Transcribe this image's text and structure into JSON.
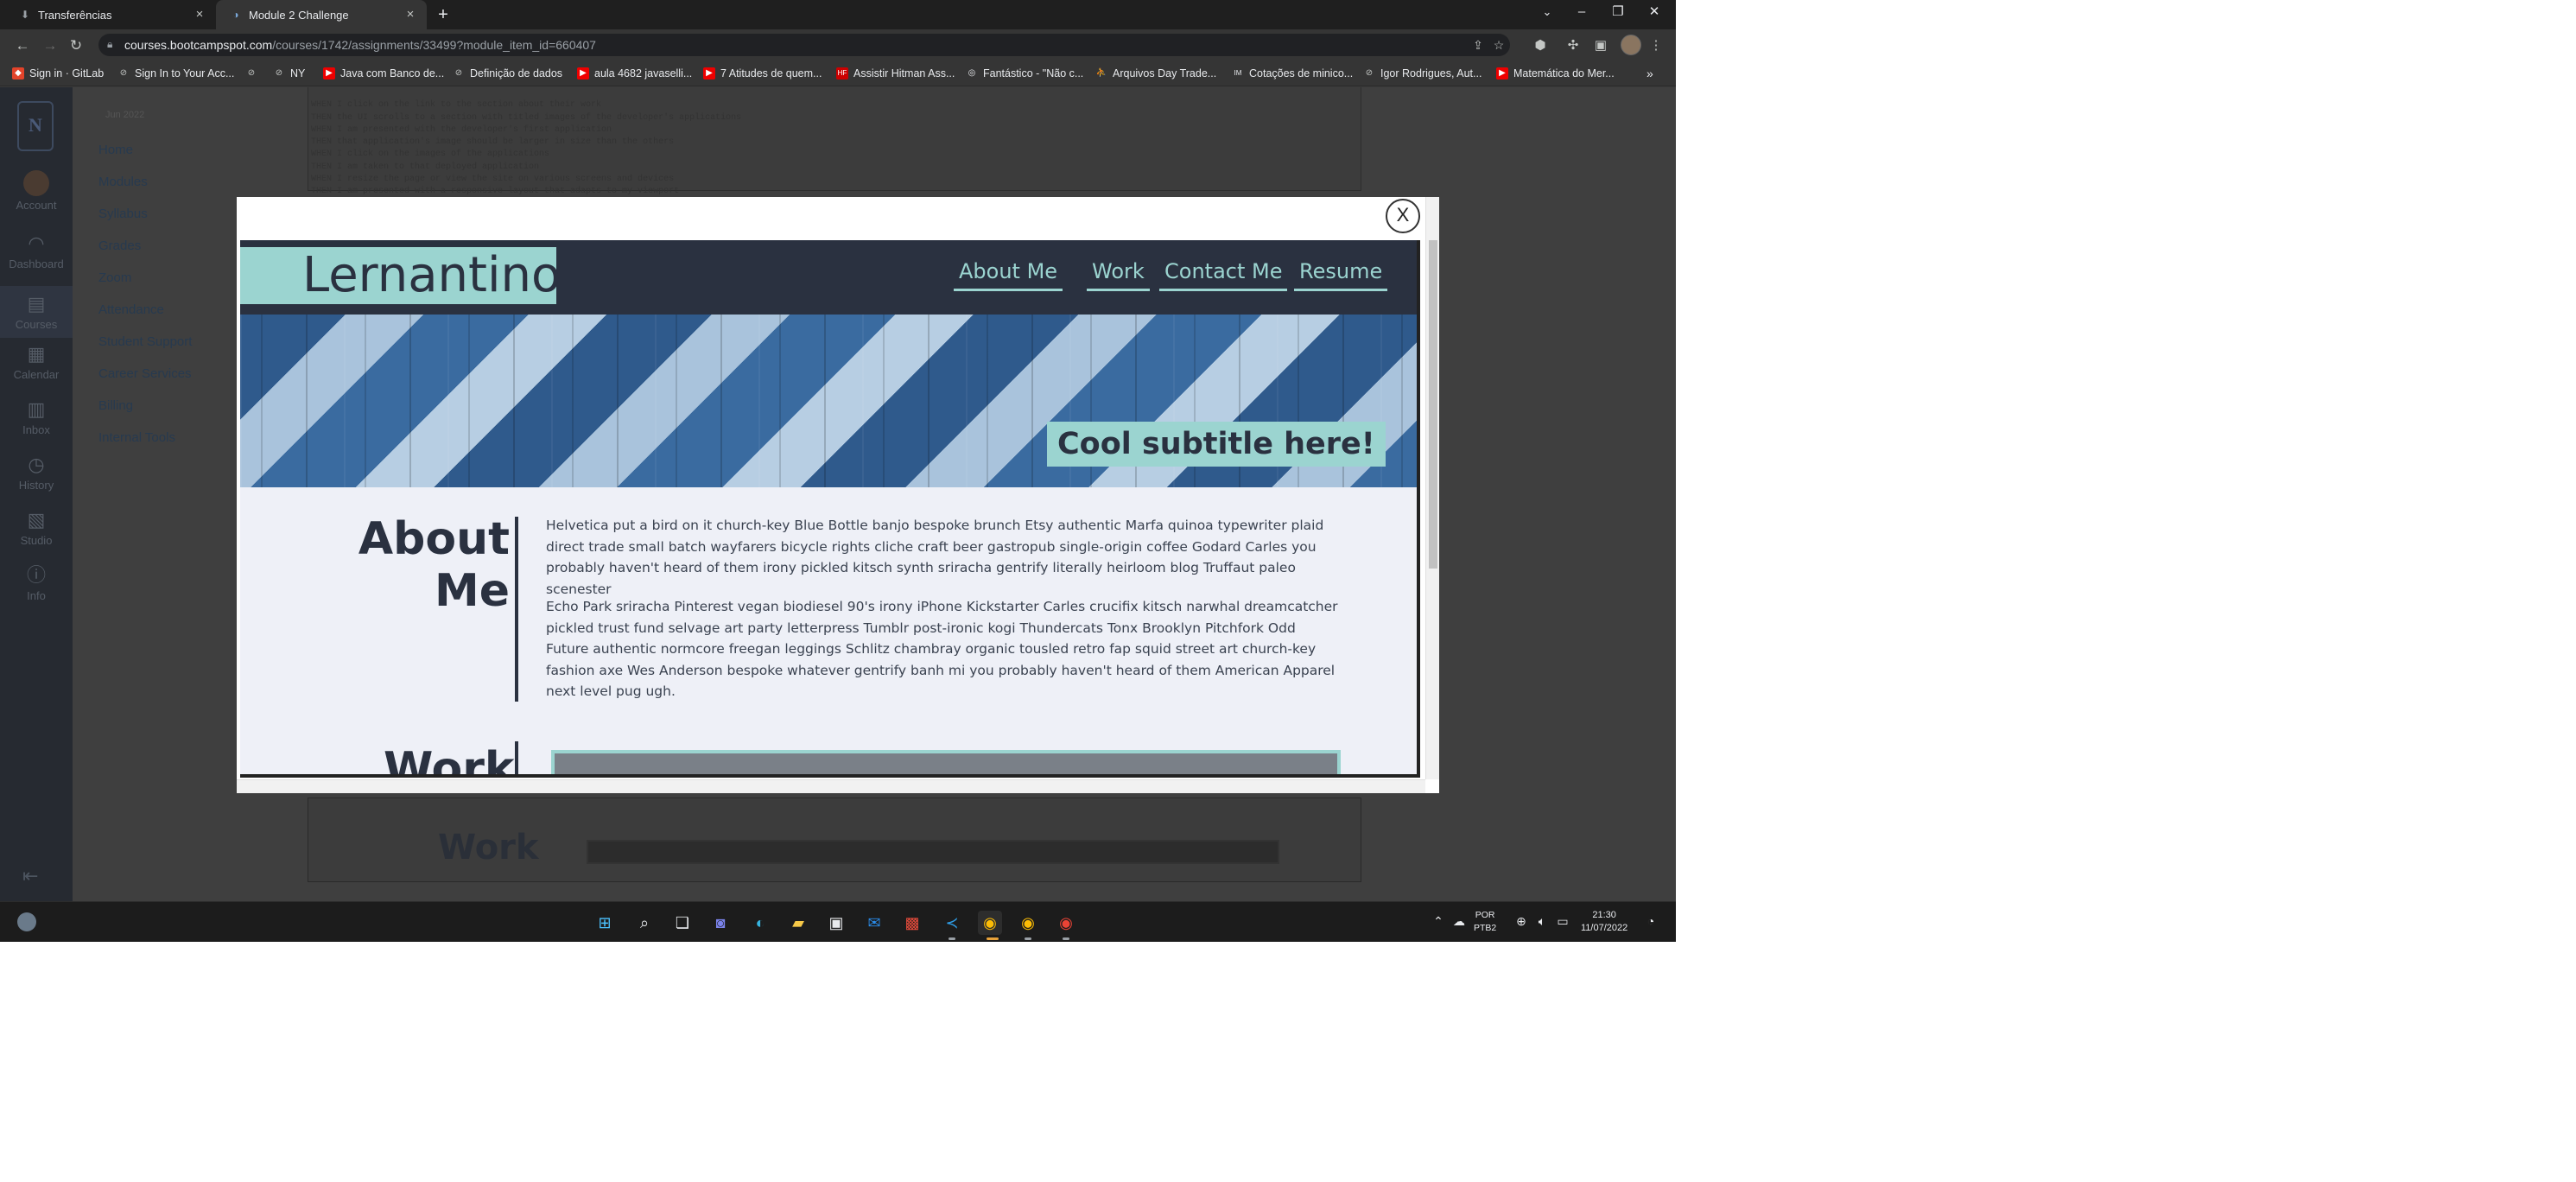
{
  "browser": {
    "tabs": [
      {
        "title": "Transferências",
        "icon": "download-icon"
      },
      {
        "title": "Module 2 Challenge",
        "icon": "canvas-icon"
      }
    ],
    "url_domain": "courses.bootcampspot.com",
    "url_path": "/courses/1742/assignments/33499?module_item_id=660407",
    "bookmarks": [
      "Sign in · GitLab",
      "Sign In to Your Acc...",
      "NY",
      "Java com Banco de...",
      "Definição de dados",
      "aula 4682 javaselli...",
      "7 Atitudes de quem...",
      "Assistir Hitman Ass...",
      "Fantástico - \"Não c...",
      "Arquivos Day Trade...",
      "Cotações de minico...",
      "Igor Rodrigues, Aut...",
      "Matemática do Mer..."
    ],
    "bookmark_badges": [
      "HF",
      "IM"
    ]
  },
  "lms": {
    "global_nav": [
      "Account",
      "Dashboard",
      "Courses",
      "Calendar",
      "Inbox",
      "History",
      "Studio",
      "Info"
    ],
    "course_term": "Jun 2022",
    "course_nav": [
      "Home",
      "Modules",
      "Syllabus",
      "Grades",
      "Zoom",
      "Attendance",
      "Student Support",
      "Career Services",
      "Billing",
      "Internal Tools"
    ],
    "code_lines": [
      "WHEN I click on the link to the section about their work",
      "THEN the UI scrolls to a section with titled images of the developer's applications",
      "WHEN I am presented with the developer's first application",
      "THEN that application's image should be larger in size than the others",
      "WHEN I click on the images of the applications",
      "THEN I am taken to that deployed application",
      "WHEN I resize the page or view the site on various screens and devices",
      "THEN I am presented with a responsive layout that adapts to my viewport"
    ],
    "bottom_heading": "Work"
  },
  "modal": {
    "close_label": "X",
    "site": {
      "logo": "Lernantino",
      "nav": [
        "About Me",
        "Work",
        "Contact Me",
        "Resume"
      ],
      "hero_subtitle": "Cool subtitle here!",
      "about_heading_line1": "About",
      "about_heading_line2": "Me",
      "about_p1": "Helvetica put a bird on it church-key Blue Bottle banjo bespoke brunch Etsy authentic Marfa quinoa typewriter plaid direct trade small batch wayfarers bicycle rights cliche craft beer gastropub single-origin coffee Godard Carles you probably haven't heard of them irony pickled kitsch synth sriracha gentrify literally heirloom blog Truffaut paleo scenester",
      "about_p2": "Echo Park sriracha Pinterest vegan biodiesel 90's irony iPhone Kickstarter Carles crucifix kitsch narwhal dreamcatcher pickled trust fund selvage art party letterpress Tumblr post-ironic kogi Thundercats Tonx Brooklyn Pitchfork Odd Future authentic normcore freegan leggings Schlitz chambray organic tousled retro fap squid street art church-key fashion axe Wes Anderson bespoke whatever gentrify banh mi you probably haven't heard of them American Apparel next level pug ugh.",
      "work_heading": "Work"
    },
    "colors": {
      "accent": "#9bd4d0",
      "dark": "#2a3140",
      "page_bg": "#eef0f7"
    }
  },
  "taskbar": {
    "apps": [
      "start-icon",
      "search-icon",
      "task-view-icon",
      "teams-chat-icon",
      "edge-icon",
      "file-explorer-icon",
      "store-icon",
      "mail-icon",
      "gift-app-icon",
      "vscode-icon",
      "chrome-icon",
      "chrome-profile-icon",
      "chrome-alt-icon"
    ],
    "lang_line1": "POR",
    "lang_line2": "PTB2",
    "time": "21:30",
    "date": "11/07/2022"
  }
}
